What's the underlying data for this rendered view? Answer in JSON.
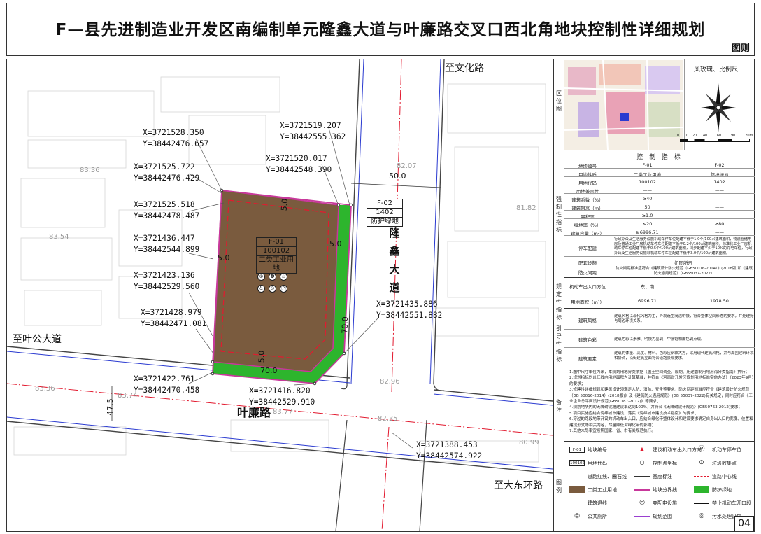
{
  "title": "F—县先进制造业开发区南编制单元隆鑫大道与叶廉路交叉口西北角地块控制性详细规划",
  "title_tag": "图则",
  "roads": {
    "north": "至文化路",
    "west": "至叶公大道",
    "south_road": "叶廉路",
    "southeast": "至大东环路",
    "vertical_chars": [
      "隆",
      "鑫",
      "大",
      "道"
    ]
  },
  "coords": [
    {
      "x": "X=3721528.350",
      "y": "Y=38442476.657"
    },
    {
      "x": "X=3721525.722",
      "y": "Y=38442476.429"
    },
    {
      "x": "X=3721525.518",
      "y": "Y=38442478.487"
    },
    {
      "x": "X=3721436.447",
      "y": "Y=38442544.899"
    },
    {
      "x": "X=3721423.136",
      "y": "Y=38442529.560"
    },
    {
      "x": "X=3721428.979",
      "y": "Y=38442471.081"
    },
    {
      "x": "X=3721422.761",
      "y": "Y=38442470.458"
    },
    {
      "x": "X=3721416.820",
      "y": "Y=38442529.910"
    },
    {
      "x": "X=3721519.207",
      "y": "Y=38442555.362"
    },
    {
      "x": "X=3721520.017",
      "y": "Y=38442548.390"
    },
    {
      "x": "X=3721435.886",
      "y": "Y=38442551.882"
    },
    {
      "x": "X=3721388.453",
      "y": "Y=38442574.922"
    }
  ],
  "elevations": [
    "83.36",
    "83.54",
    "82.07",
    "81.82",
    "82.96",
    "83.36",
    "83.74",
    "83.77",
    "82.35",
    "80.99"
  ],
  "dims": {
    "top_5": "5.0",
    "left_5": "5.0",
    "right_5": "5.0",
    "bottom_5": "5.0",
    "height_70": "70.0",
    "width_70": "70.0",
    "road_50": "50.0",
    "road_47": "47.5"
  },
  "plot_f01": [
    "F-01",
    "100102",
    "二类工业用地"
  ],
  "plot_f02": [
    "F-02",
    "1402",
    "防护绿地"
  ],
  "symbols": [
    "⊕",
    "❸",
    "♨",
    "♿",
    "⊙",
    "Ⓟ"
  ],
  "colors": {
    "industrial": "#7a5b3e",
    "green": "#2db52d",
    "road_red": "#e21a2f",
    "road_blue": "#2a3ad0",
    "boundary_magenta": "#c8389b"
  },
  "panel": {
    "loc_label": "区位图",
    "compass_title": "风玫瑰、比例尺",
    "scale": [
      "0",
      "10",
      "20",
      "40",
      "60",
      "90",
      "120m"
    ],
    "table_title": "控 制 指 标",
    "head": {
      "c1": "地块编号",
      "c2": "F-01",
      "c3": "F-02"
    },
    "strong_label": "强制性指标",
    "strong_rows": [
      {
        "name": "用地性质",
        "v1": "二类工业用地",
        "v2": "防护绿地"
      },
      {
        "name": "用地代码",
        "v1": "100102",
        "v2": "1402"
      },
      {
        "name": "用地兼容性",
        "v1": "——",
        "v2": "——"
      },
      {
        "name": "建筑系数（%）",
        "v1": "≥40",
        "v2": "——"
      },
      {
        "name": "建筑限高（m）",
        "v1": "50",
        "v2": "——"
      },
      {
        "name": "容积率",
        "v1": "≥1.0",
        "v2": "——"
      },
      {
        "name": "绿地率（%）",
        "v1": "≤20",
        "v2": "≥80"
      },
      {
        "name": "建筑容量（m²）",
        "v1": "≥6996.71",
        "v2": "——"
      }
    ],
    "parking_name": "停车配建",
    "parking_text": "行政办公及生活服务设施机动车停车位配建不低于1.0个/100㎡建筑面积，物流仓储用房及普通工业厂房机动车停车位配建不低于0.2个/100㎡建筑面积，标准化工业厂房机动车停车位配建不低于0.5个/100㎡建筑面积，同步配建不少于10%的充电车位，行政办公及生活服务设施非机动车停车位配建不低于3.0个/100㎡建筑面积。",
    "facility_name": "配套设施",
    "facility_value": "如图所示",
    "fire_name": "防火间距",
    "fire_value": "防火间距标准应符合《建筑设计防火规范（GB50016-2014）》(2018版)和《建筑防火通用规范》（GB55037-2022）",
    "regulatory_label": "规定性指标",
    "reg_rows": [
      {
        "name": "机动车出入口方位",
        "v1": "东、南",
        "v2": ""
      },
      {
        "name": "用地面积（m²）",
        "v1": "6996.71",
        "v2": "1978.50"
      }
    ],
    "guide_label": "引导性指标",
    "guide_rows": [
      {
        "name": "建筑风格",
        "text": "建筑风格以现代风格为主，外观造型简洁明快，符合整体空间形态的要求，并处理好与周边环境关系。"
      },
      {
        "name": "建筑色彩",
        "text": "建筑色彩以素雅、明快为基调，中低饱和度色调点缀。"
      },
      {
        "name": "建筑要素",
        "text": "建筑的体量、高度、材料、色彩应新颖大方，采用现代建筑风格，并与周围建筑环境相协调，沿街建筑立面符合道路景观要求。"
      }
    ],
    "notes_label": "备注",
    "notes": [
      "1.图中尺寸单位为米，本规划用地分类依据《国土空间调查、规划、用途管制用地用海分类指南》执行；",
      "2.规划指标均以红线内用地面积为计算基准，并符合《河南省开发区规划用地标准实施办法》（2023年9月）的要求；",
      "3.修建性详细规划和建筑设计须满足人防、消防、安全等要求，防火间距标准应符合《建筑设计防火规范（GB 50016-2014）(2018版)》及《建筑防火通用规范》(GB 55037-2022)有关规定，同时应符合《工业企业总平面设计规范(GB50187-2012)》等要求；",
      "4.规划地块内的无障碍设施建设率达到100%，并符合《无障碍设计规范》(GB50763-2012)要求；",
      "5.项目实施应结合海绵城市建设，落实《海绵城市建设技术指南》的要求；",
      "6.穿过的路段地带开设的机动车出入口，应结合绿化带整体设计和建设要求确定自身出入口的宽度、位置和建设形式等相关内容，尽量降低对绿化带的影响；",
      "7.其他未尽事宜按照国家、省、市有关规范执行。"
    ],
    "legend_label": "图例",
    "legend": [
      {
        "t": "地块编号",
        "k": "F-01",
        "c": "box"
      },
      {
        "t": "建议机动车出入口方向",
        "k": "",
        "c": "arrow"
      },
      {
        "t": "机动车停车位",
        "k": "",
        "c": "p"
      },
      {
        "t": "用地代码",
        "k": "100102",
        "c": "box"
      },
      {
        "t": "控制点坐标",
        "k": "",
        "c": "dot"
      },
      {
        "t": "垃圾收集点",
        "k": "",
        "c": "trash"
      },
      {
        "t": "道路红线、圈石线",
        "k": "",
        "c": "line2"
      },
      {
        "t": "宽度标注",
        "k": "",
        "c": "dimline"
      },
      {
        "t": "道路中心线",
        "k": "",
        "c": "center"
      },
      {
        "t": "二类工业用地",
        "k": "",
        "c": "brown"
      },
      {
        "t": "地块分界线",
        "k": "",
        "c": "magenta"
      },
      {
        "t": "防护绿地",
        "k": "",
        "c": "green"
      },
      {
        "t": "建筑退线",
        "k": "",
        "c": "dashred"
      },
      {
        "t": "变配电设施",
        "k": "",
        "c": "sym"
      },
      {
        "t": "禁止机动车开口段",
        "k": "",
        "c": "ban"
      },
      {
        "t": "公共厕所",
        "k": "",
        "c": "sym"
      },
      {
        "t": "规划范围",
        "k": "",
        "c": "purple"
      },
      {
        "t": "污水处理设施",
        "k": "",
        "c": "sym"
      }
    ],
    "page_no": "04"
  }
}
